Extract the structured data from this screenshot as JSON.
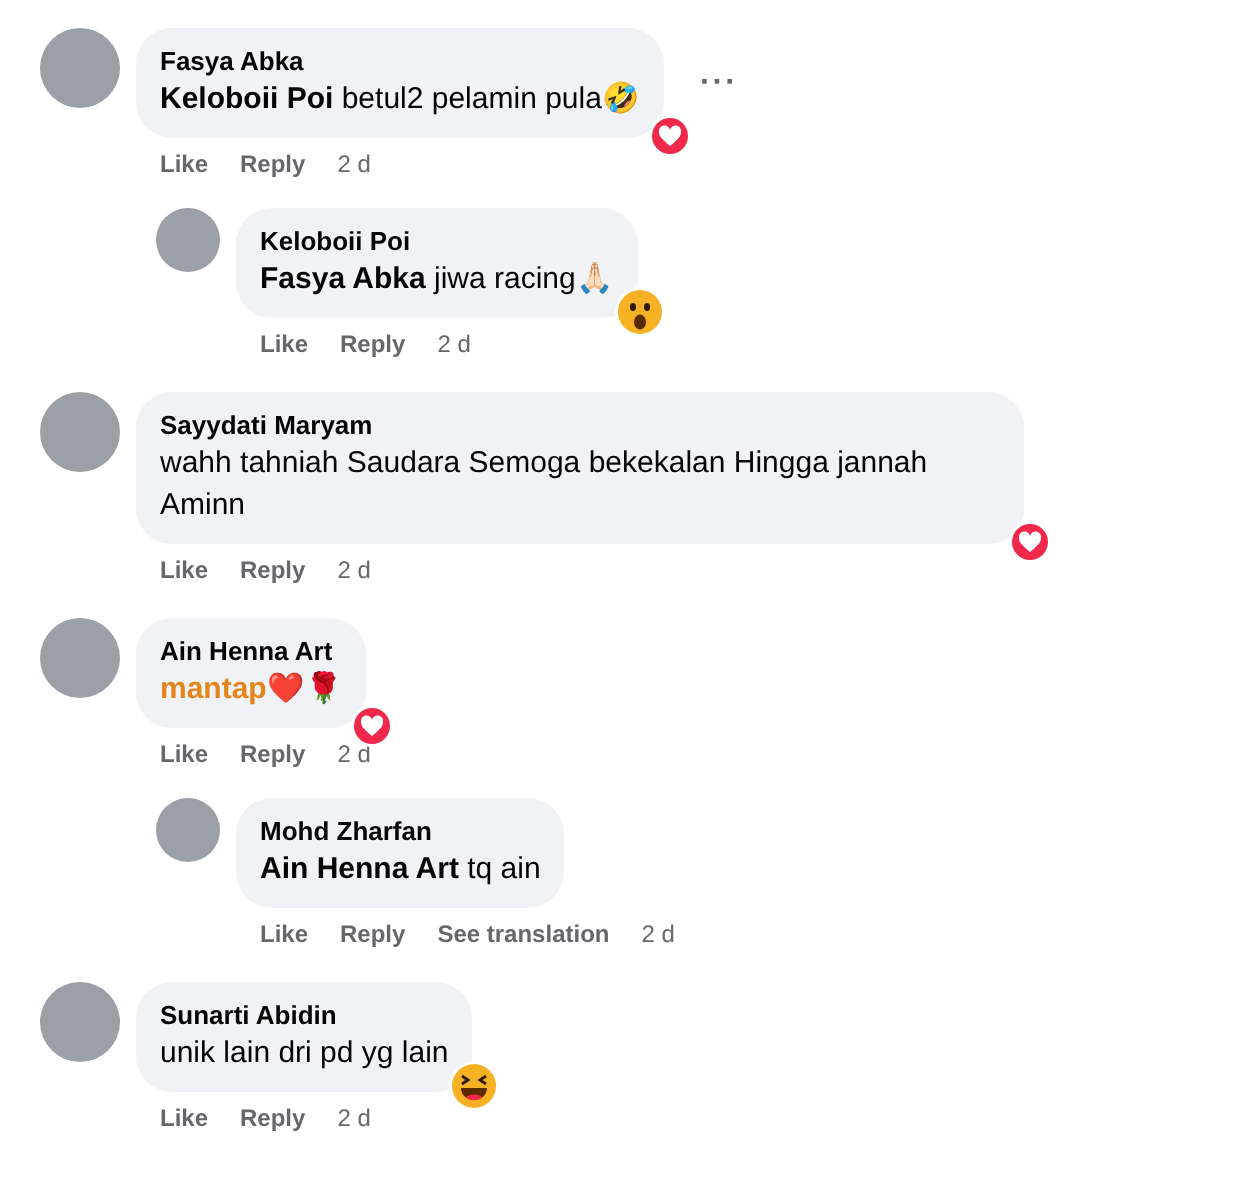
{
  "comments": [
    {
      "author": "Fasya Abka",
      "text": "**Keloboii Poi** betul2 pelamin pula🤣",
      "emphasis": false,
      "reaction": {
        "kind": "love"
      },
      "more_menu": "···",
      "actions": [
        "Like",
        "Reply",
        "2 d"
      ],
      "replies": [
        {
          "author": "Keloboii Poi",
          "text": "**Fasya Abka** jiwa racing🙏🏻",
          "emphasis": false,
          "reaction": {
            "kind": "wow"
          },
          "actions": [
            "Like",
            "Reply",
            "2 d"
          ]
        }
      ]
    },
    {
      "author": "Sayydati Maryam",
      "text": "wahh tahniah Saudara Semoga bekekalan Hingga jannah Aminn",
      "emphasis": false,
      "reaction": {
        "kind": "love"
      },
      "actions": [
        "Like",
        "Reply",
        "2 d"
      ]
    },
    {
      "author": "Ain Henna Art",
      "text": "mantap❤️🌹",
      "emphasis": true,
      "reaction": {
        "kind": "love"
      },
      "actions": [
        "Like",
        "Reply",
        "2 d"
      ],
      "replies": [
        {
          "author": "Mohd Zharfan",
          "text": "**Ain Henna Art** tq ain",
          "emphasis": false,
          "actions": [
            "Like",
            "Reply",
            "See translation",
            "2 d"
          ]
        }
      ]
    },
    {
      "author": "Sunarti Abidin",
      "text": "unik lain dri pd yg lain",
      "emphasis": false,
      "reaction": {
        "kind": "haha"
      },
      "actions": [
        "Like",
        "Reply",
        "2 d"
      ]
    }
  ]
}
